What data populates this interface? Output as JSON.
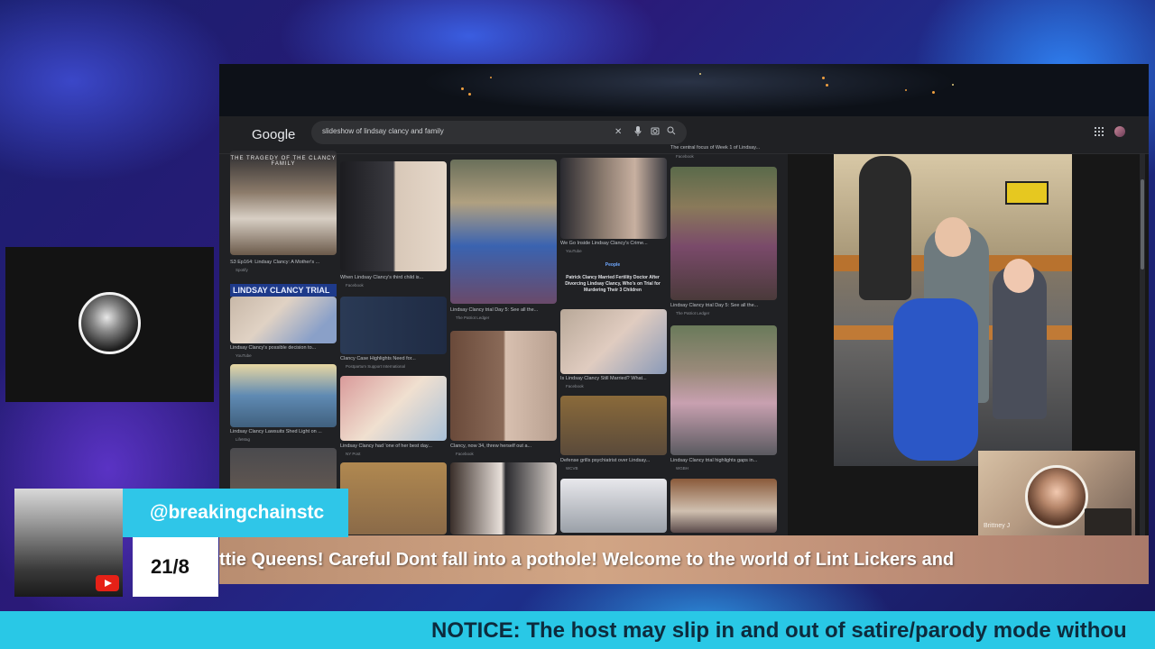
{
  "stream": {
    "handle": "@breakingchainstc",
    "counter": "21/8",
    "ticker": "ttie Queens!  Careful Dont fall into a pothole!            Welcome to the world of Lint Lickers and",
    "notice": "NOTICE: The host may slip in and out of satire/parody mode withou"
  },
  "guest": {
    "name": "Brittney J"
  },
  "browser": {
    "logo": "Google",
    "query": "slideshow of lindsay clancy and family"
  },
  "results": {
    "col1": [
      {
        "title": "THE TRAGEDY OF THE CLANCY FAMILY",
        "caption": "S3 Ep164: Lindsay Clancy: A Mother's ...",
        "source": "Spotify"
      },
      {
        "title": "LINDSAY CLANCY TRIAL",
        "caption": "Lindsay Clancy's possible decision to...",
        "source": "YouTube"
      },
      {
        "caption": "Lindsay Clancy Lawsuits Shed Light on ...",
        "source": "LifeMag"
      }
    ],
    "col2": [
      {
        "caption": "When Lindsay Clancy's third child is...",
        "source": "Facebook"
      },
      {
        "caption": "Clancy Case Highlights Need for...",
        "source": "Postpartum Support International"
      },
      {
        "caption": "Lindsay Clancy had 'one of her best day...",
        "source": "NY Post"
      }
    ],
    "col3": [
      {
        "caption": "Lindsay Clancy trial Day 5: See all the...",
        "source": "The Patriot Ledger"
      },
      {
        "caption": "Clancy, now 34, threw herself out a...",
        "source": "Facebook"
      }
    ],
    "col4": [
      {
        "caption": "We Go Inside Lindsay Clancy's Crime...",
        "source": "YouTube"
      },
      {
        "headline_top": "People",
        "headline": "Patrick Clancy Married Fertility Doctor After Divorcing Lindsay Clancy, Who's on Trial for Murdering Their 3 Children"
      },
      {
        "caption": "Is Lindsay Clancy Still Married? What...",
        "source": "Facebook"
      },
      {
        "caption": "Defense grills psychiatrist over Lindsay...",
        "source": "WCVB"
      }
    ],
    "col5": [
      {
        "caption": "The central focus of Week 1 of Lindsay...",
        "source": "Facebook"
      },
      {
        "caption": "Lindsay Clancy trial Day 5: See all the...",
        "source": "The Patriot Ledger"
      },
      {
        "caption": "Lindsay Clancy trial highlights gaps in...",
        "source": "WGBH"
      }
    ]
  },
  "icons": {
    "clear": "close-icon",
    "mic": "mic-icon",
    "lens": "lens-icon",
    "search": "search-icon",
    "apps": "apps-grid-icon",
    "youtube": "youtube-icon"
  },
  "colors": {
    "handle_bg": "#2fc6e8",
    "notice_bg": "#29c8e6",
    "youtube_red": "#e62117"
  }
}
